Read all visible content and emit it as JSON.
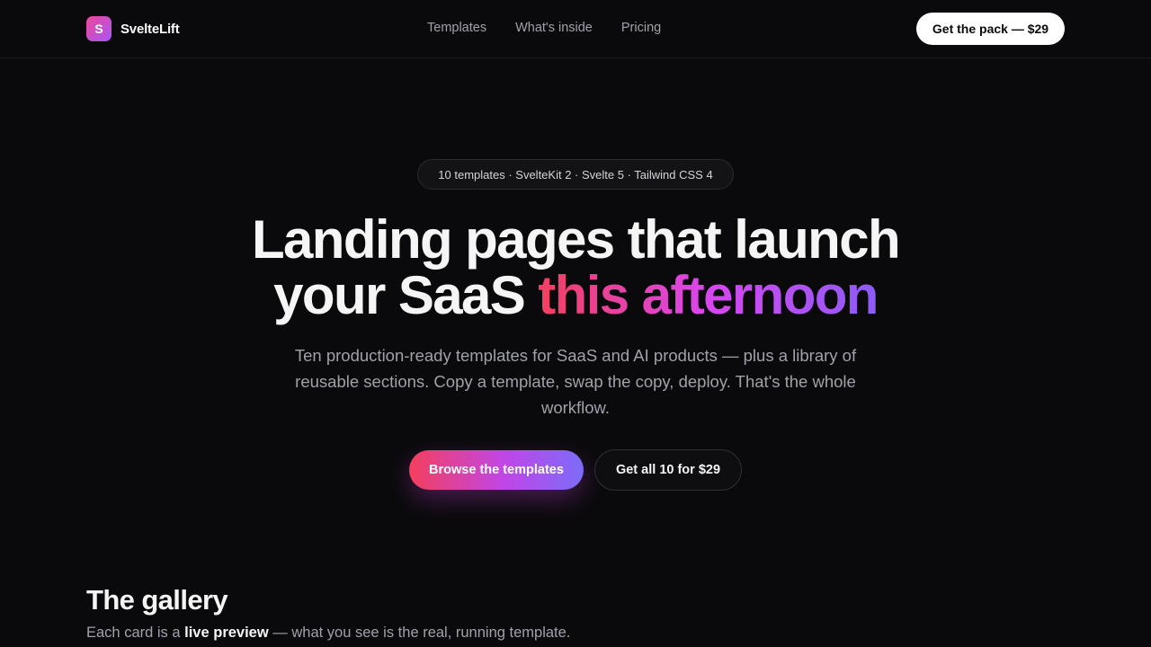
{
  "header": {
    "brand_letter": "S",
    "brand_name": "SvelteLift",
    "nav": [
      "Templates",
      "What's inside",
      "Pricing"
    ],
    "cta": "Get the pack — $29"
  },
  "hero": {
    "badge": "10 templates · SvelteKit 2 · Svelte 5 · Tailwind CSS 4",
    "title_line1": "Landing pages that launch",
    "title_line2_plain": "your SaaS ",
    "title_line2_gradient": "this afternoon",
    "subtitle": "Ten production-ready templates for SaaS and AI products — plus a library of reusable sections. Copy a template, swap the copy, deploy. That's the whole workflow.",
    "primary_button": "Browse the templates",
    "secondary_button": "Get all 10 for $29"
  },
  "gallery": {
    "title": "The gallery",
    "sub_before": "Each card is a ",
    "sub_strong": "live preview",
    "sub_after": " — what you see is the real, running template."
  },
  "colors": {
    "background": "#0a0a0c",
    "accent_start": "#f43f5e",
    "accent_mid": "#d946ef",
    "accent_end": "#8b5cf6"
  }
}
